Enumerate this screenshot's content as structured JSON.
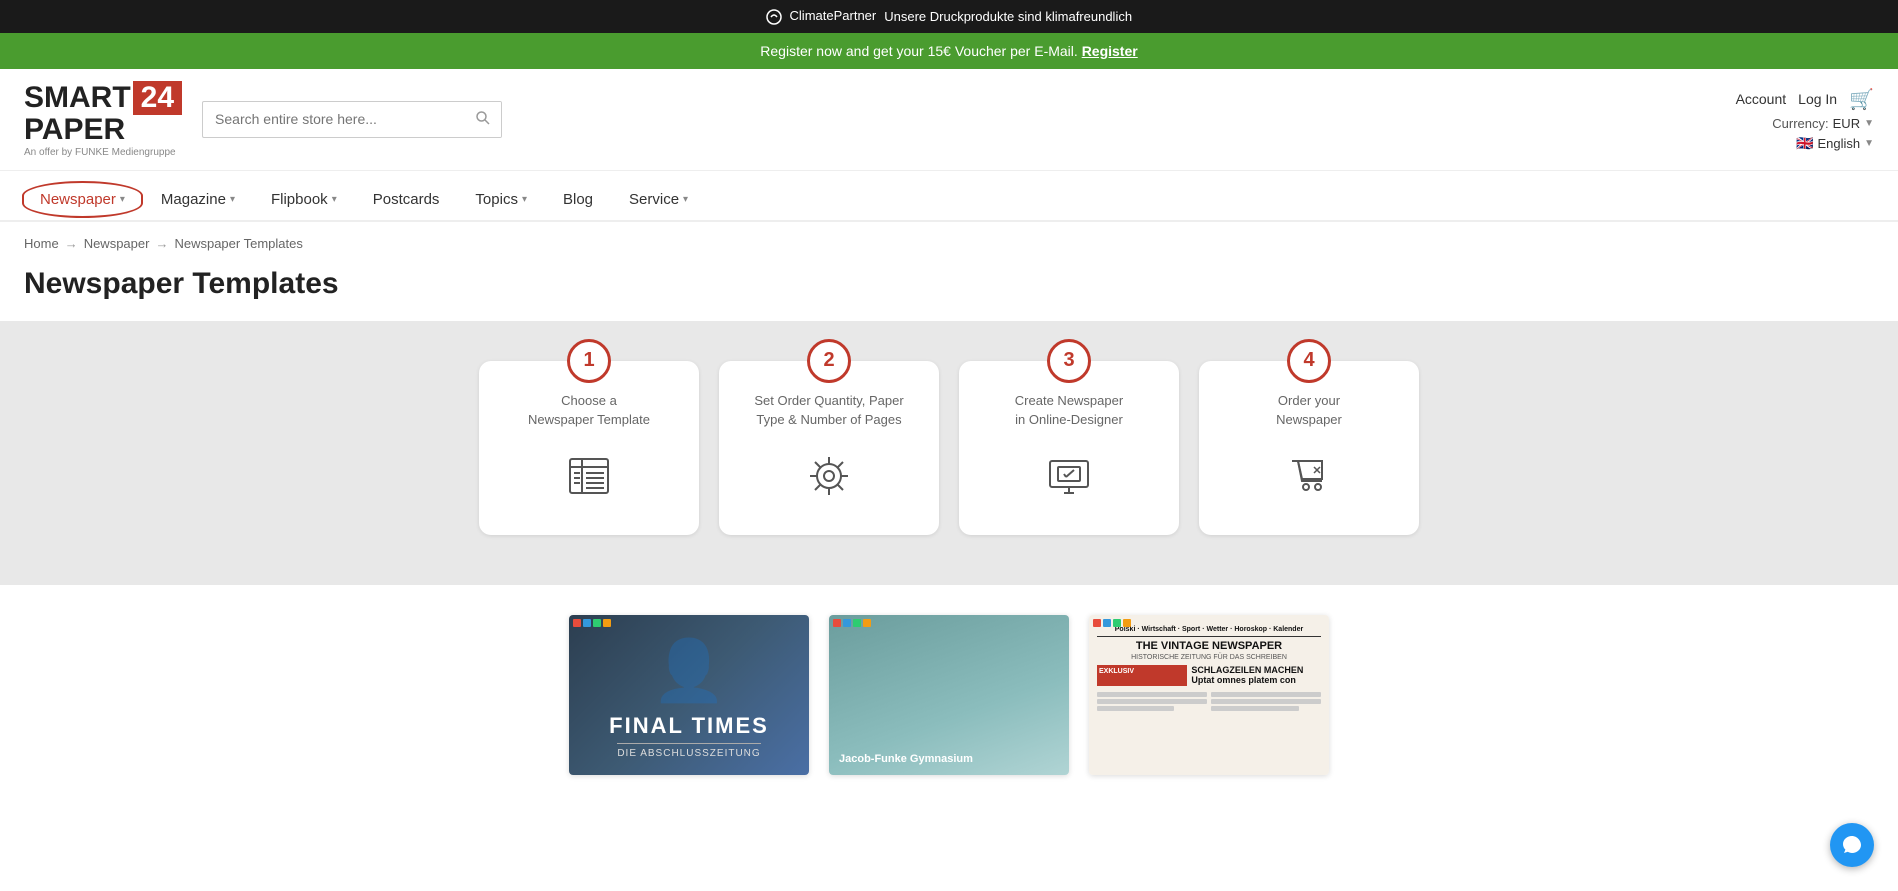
{
  "topBar": {
    "logo": "ClimatePartner",
    "message": "Unsere Druckprodukte sind klimafreundlich"
  },
  "promoBar": {
    "text": "Register now and get your 15€ Voucher per E-Mail.",
    "linkText": "Register"
  },
  "header": {
    "logo": {
      "smart": "SMART",
      "paper": "PAPER",
      "num": "24",
      "tagline": "An offer by FUNKE Mediengruppe"
    },
    "search": {
      "placeholder": "Search entire store here..."
    },
    "account": "Account",
    "login": "Log In",
    "currency": {
      "label": "Currency:",
      "value": "EUR"
    },
    "language": {
      "flag": "🇬🇧",
      "value": "English"
    }
  },
  "nav": {
    "items": [
      {
        "label": "Newspaper",
        "hasArrow": true,
        "circled": true
      },
      {
        "label": "Magazine",
        "hasArrow": true,
        "circled": false
      },
      {
        "label": "Flipbook",
        "hasArrow": true,
        "circled": false
      },
      {
        "label": "Postcards",
        "hasArrow": false,
        "circled": false
      },
      {
        "label": "Topics",
        "hasArrow": true,
        "circled": false
      },
      {
        "label": "Blog",
        "hasArrow": false,
        "circled": false
      },
      {
        "label": "Service",
        "hasArrow": true,
        "circled": false
      }
    ]
  },
  "breadcrumb": {
    "items": [
      "Home",
      "Newspaper",
      "Newspaper Templates"
    ]
  },
  "pageTitle": "Newspaper Templates",
  "steps": [
    {
      "number": "1",
      "label": "Choose a\nNewspaper Template",
      "icon": "📰"
    },
    {
      "number": "2",
      "label": "Set Order Quantity, Paper\nType & Number of Pages",
      "icon": "⚙️"
    },
    {
      "number": "3",
      "label": "Create Newspaper\nin Online-Designer",
      "icon": "🖥️"
    },
    {
      "number": "4",
      "label": "Order your\nNewspaper",
      "icon": "🛒"
    }
  ],
  "templates": [
    {
      "title": "FINAL TIMES",
      "subtitle": "DIE ABSCHLUSSZEITUNG",
      "type": "final-times"
    },
    {
      "title": "Jacob-Funke Gymnasium",
      "type": "teal"
    },
    {
      "title": "THE VINTAGE NEWSPAPER",
      "type": "vintage"
    }
  ],
  "chat": {
    "icon": "💬"
  }
}
